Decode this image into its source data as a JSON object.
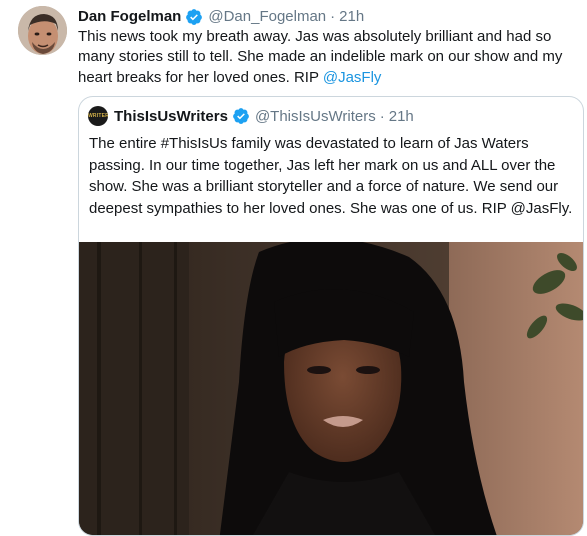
{
  "tweet": {
    "author_name": "Dan Fogelman",
    "handle": "@Dan_Fogelman",
    "separator": "·",
    "time": "21h",
    "text": "This news took my breath away. Jas was absolutely brilliant and had so many stories still to tell.  She made an indelible mark on our show and my heart breaks for her loved ones. RIP ",
    "mention": "@JasFly"
  },
  "quoted_tweet": {
    "author_name": "ThisIsUsWriters",
    "avatar_text": "WRITERS",
    "handle": "@ThisIsUsWriters",
    "separator": "·",
    "time": "21h",
    "text": "The entire #ThisIsUs family was devastated to learn of Jas Waters passing. In our time together, Jas left her mark on us and ALL over the show. She was a brilliant storyteller and a force of nature. We send our deepest sympathies to her loved ones. She was one of us. RIP @JasFly."
  },
  "icons": {
    "verified": "verified-badge-icon",
    "accent": "#1da1f2",
    "link": "#1b95e0"
  }
}
